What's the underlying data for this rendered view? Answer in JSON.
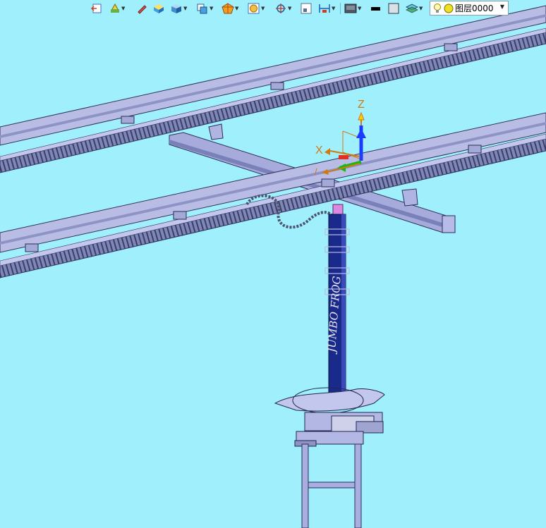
{
  "toolbar": {
    "icons": [
      "exit-sketch-icon",
      "sketch-tools-icon",
      "pen-icon",
      "box-view-icon",
      "solid-view-icon",
      "view-orientation-icon",
      "section-view-icon",
      "render-mode-icon",
      "snap-target-icon",
      "frame-icon",
      "dimension-icon",
      "display-style-icon",
      "line-color-icon",
      "fill-color-icon",
      "layer-stack-icon"
    ],
    "layer_selector": {
      "value": "图层0000",
      "bulb_icon": "lightbulb-icon",
      "status_icon": "layer-status-icon"
    }
  },
  "viewport": {
    "background_color": "#9ff0fc",
    "triad": {
      "z_label": "Z",
      "x_label": "X",
      "y_label": "/",
      "z_color": "#1a3cff",
      "y_color": "#18b818",
      "label_color": "#d07a10"
    },
    "column_text": "JUMBO FROG",
    "model_color": "#a9aee0",
    "column_color": "#1a2a8a"
  }
}
